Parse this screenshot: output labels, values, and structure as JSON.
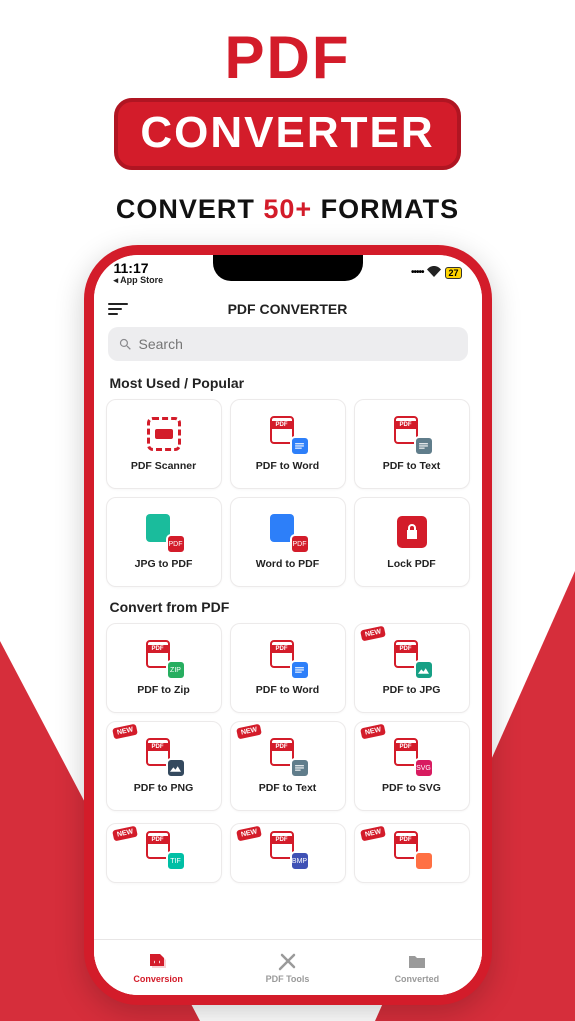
{
  "hero": {
    "line1": "PDF",
    "line2": "CONVERTER",
    "sub_pre": "CONVERT ",
    "sub_accent": "50+",
    "sub_post": " FORMATS"
  },
  "status": {
    "time": "11:17",
    "back": "◂ App Store",
    "battery": "27"
  },
  "header": {
    "title": "PDF CONVERTER"
  },
  "search": {
    "placeholder": "Search"
  },
  "sections": {
    "popular": {
      "title": "Most Used / Popular"
    },
    "convert": {
      "title": "Convert from PDF"
    }
  },
  "cards": {
    "p1": "PDF Scanner",
    "p2": "PDF to Word",
    "p3": "PDF to Text",
    "p4": "JPG to PDF",
    "p5": "Word to PDF",
    "p6": "Lock PDF",
    "c1": "PDF to Zip",
    "c2": "PDF to Word",
    "c3": "PDF to JPG",
    "c4": "PDF to PNG",
    "c5": "PDF to Text",
    "c6": "PDF to SVG"
  },
  "badges": {
    "new": "NEW"
  },
  "nav": {
    "conversion": "Conversion",
    "tools": "PDF Tools",
    "converted": "Converted"
  },
  "overlay_labels": {
    "zip": "ZIP",
    "svg": "SVG",
    "tif": "TIF",
    "bmp": "BMP"
  }
}
